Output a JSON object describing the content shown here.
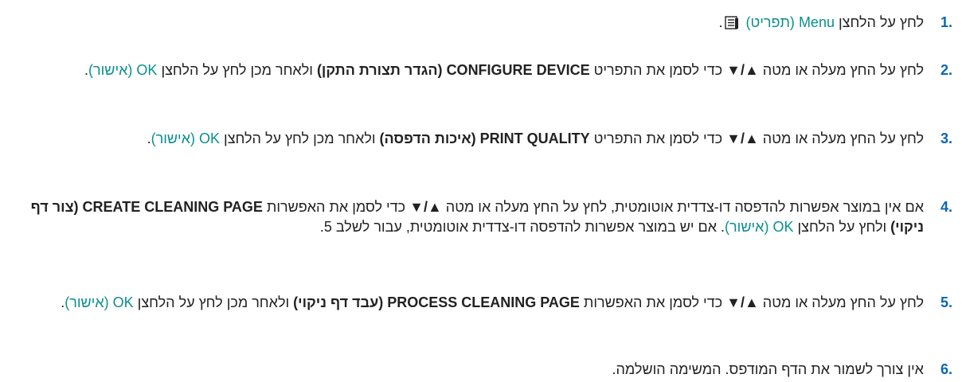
{
  "steps": [
    {
      "number": ".1",
      "pre": "לחץ על הלחצן ",
      "key": "Menu (תפריט)",
      "post": " ",
      "icon": "menu-icon",
      "end": "."
    },
    {
      "number": ".2",
      "pre": "לחץ על החץ מעלה או מטה ",
      "arrows": "▲/▼",
      "mid": " כדי לסמן את התפריט ",
      "bold": "CONFIGURE DEVICE (הגדר תצורת התקן)",
      "mid2": " ולאחר מכן לחץ על הלחצן ",
      "key": "OK (אישור)",
      "end": "."
    },
    {
      "number": ".3",
      "pre": "לחץ על החץ מעלה או מטה ",
      "arrows": "▲/▼",
      "mid": " כדי לסמן את התפריט ",
      "bold": "PRINT QUALITY (איכות הדפסה)",
      "mid2": " ולאחר מכן לחץ על הלחצן ",
      "key": "OK (אישור)",
      "end": "."
    },
    {
      "number": ".4",
      "pre": "אם אין במוצר אפשרות להדפסה דו-צדדית אוטומטית, לחץ על החץ מעלה או מטה ",
      "arrows": "▲/▼",
      "mid": " כדי לסמן את האפשרות ",
      "bold": "CREATE CLEANING PAGE (צור דף ניקוי)",
      "mid2": " ולחץ על הלחצן ",
      "key": "OK (אישור)",
      "end": ". אם יש במוצר אפשרות להדפסה דו-צדדית אוטומטית, עבור לשלב 5."
    },
    {
      "number": ".5",
      "pre": "לחץ על החץ מעלה או מטה ",
      "arrows": "▲/▼",
      "mid": " כדי לסמן את האפשרות ",
      "bold": "PROCESS CLEANING PAGE (עבד דף ניקוי)",
      "mid2": " ולאחר מכן לחץ על הלחצן ",
      "key": "OK (אישור)",
      "end": "."
    },
    {
      "number": ".6",
      "pre": "אין צורך לשמור את הדף המודפס. המשימה הושלמה."
    }
  ],
  "colors": {
    "step_number": "#0a66b8",
    "key_label": "#0a8f8f",
    "text": "#222222"
  }
}
